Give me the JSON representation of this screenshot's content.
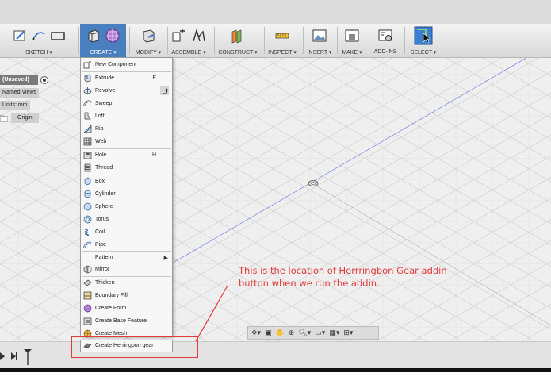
{
  "toolbar": {
    "groups": [
      {
        "label": "SKETCH ▾"
      },
      {
        "label": "CREATE ▾"
      },
      {
        "label": "MODIFY ▾"
      },
      {
        "label": "ASSEMBLE ▾"
      },
      {
        "label": "CONSTRUCT ▾"
      },
      {
        "label": "INSPECT ▾"
      },
      {
        "label": "INSERT ▾"
      },
      {
        "label": "MAKE ▾"
      },
      {
        "label": "ADD-INS"
      },
      {
        "label": "SELECT ▾"
      }
    ]
  },
  "browser": {
    "document": "(Unsaved)",
    "named_views": "Named Views",
    "units": "Units: mm",
    "origin": "Origin"
  },
  "create_menu": {
    "items": [
      {
        "label": "New Component",
        "shortcut": "",
        "icon": "new-component-icon"
      },
      {
        "label": "Extrude",
        "shortcut": "E",
        "icon": "extrude-icon"
      },
      {
        "label": "Revolve",
        "shortcut": "",
        "icon": "revolve-icon"
      },
      {
        "label": "Sweep",
        "shortcut": "",
        "icon": "sweep-icon"
      },
      {
        "label": "Loft",
        "shortcut": "",
        "icon": "loft-icon"
      },
      {
        "label": "Rib",
        "shortcut": "",
        "icon": "rib-icon"
      },
      {
        "label": "Web",
        "shortcut": "",
        "icon": "web-icon"
      },
      {
        "label": "Hole",
        "shortcut": "H",
        "icon": "hole-icon"
      },
      {
        "label": "Thread",
        "shortcut": "",
        "icon": "thread-icon"
      },
      {
        "label": "Box",
        "shortcut": "",
        "icon": "box-icon"
      },
      {
        "label": "Cylinder",
        "shortcut": "",
        "icon": "cylinder-icon"
      },
      {
        "label": "Sphere",
        "shortcut": "",
        "icon": "sphere-icon"
      },
      {
        "label": "Torus",
        "shortcut": "",
        "icon": "torus-icon"
      },
      {
        "label": "Coil",
        "shortcut": "",
        "icon": "coil-icon"
      },
      {
        "label": "Pipe",
        "shortcut": "",
        "icon": "pipe-icon"
      },
      {
        "label": "Pattern",
        "shortcut": "",
        "icon": "pattern-icon"
      },
      {
        "label": "Mirror",
        "shortcut": "",
        "icon": "mirror-icon"
      },
      {
        "label": "Thicken",
        "shortcut": "",
        "icon": "thicken-icon"
      },
      {
        "label": "Boundary Fill",
        "shortcut": "",
        "icon": "boundary-fill-icon"
      },
      {
        "label": "Create Form",
        "shortcut": "",
        "icon": "create-form-icon"
      },
      {
        "label": "Create Base Feature",
        "shortcut": "",
        "icon": "base-feature-icon"
      },
      {
        "label": "Create Mesh",
        "shortcut": "",
        "icon": "create-mesh-icon"
      }
    ],
    "addin_item": {
      "label": "Create Herringbon gear",
      "icon": "herringbone-gear-icon"
    }
  },
  "annotation": {
    "line1": "This is the location of Herrringbon Gear addin",
    "line2": "button when we run the addin.",
    "color": "#e23a3a"
  },
  "colors": {
    "accent": "#4a7fbf",
    "annotation": "#e23a3a"
  }
}
